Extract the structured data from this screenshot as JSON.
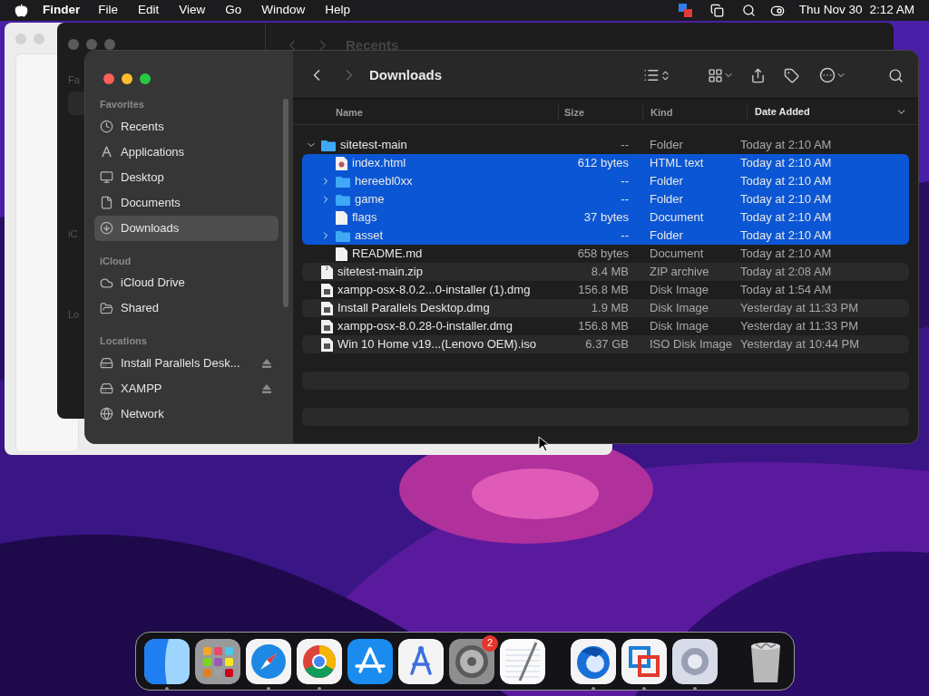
{
  "menu_bar": {
    "app": "Finder",
    "menus": [
      "File",
      "Edit",
      "View",
      "Go",
      "Window",
      "Help"
    ],
    "date": "Thu Nov 30",
    "time": "2:12 AM"
  },
  "back_window": {
    "title": "Recents",
    "sidebar_fragments": [
      "Fa",
      "iC",
      "Lo"
    ]
  },
  "finder": {
    "title": "Downloads",
    "sidebar": [
      {
        "heading": "Favorites",
        "items": [
          {
            "label": "Recents",
            "selected": false
          },
          {
            "label": "Applications",
            "selected": false
          },
          {
            "label": "Desktop",
            "selected": false
          },
          {
            "label": "Documents",
            "selected": false
          },
          {
            "label": "Downloads",
            "selected": true
          }
        ]
      },
      {
        "heading": "iCloud",
        "items": [
          {
            "label": "iCloud Drive",
            "selected": false
          },
          {
            "label": "Shared",
            "selected": false
          }
        ]
      },
      {
        "heading": "Locations",
        "items": [
          {
            "label": "Install Parallels Desk...",
            "selected": false,
            "ejectable": true
          },
          {
            "label": "XAMPP",
            "selected": false,
            "ejectable": true
          },
          {
            "label": "Network",
            "selected": false,
            "ejectable": false
          }
        ]
      }
    ],
    "columns": [
      {
        "label": "Name",
        "sorted": false
      },
      {
        "label": "Size",
        "sorted": false
      },
      {
        "label": "Kind",
        "sorted": false
      },
      {
        "label": "Date Added",
        "sorted": true
      }
    ],
    "rows": [
      {
        "name": "sitetest-main",
        "size": "--",
        "file_kind": "Folder",
        "date": "Today at 2:10 AM",
        "kind": "folder",
        "selected": false,
        "expanded": true,
        "children": [
          {
            "name": "index.html",
            "size": "612 bytes",
            "file_kind": "HTML text",
            "date": "Today at 2:10 AM",
            "kind": "html",
            "selected": true
          },
          {
            "name": "hereebl0xx",
            "size": "--",
            "file_kind": "Folder",
            "date": "Today at 2:10 AM",
            "kind": "folder",
            "selected": true,
            "expanded": false
          },
          {
            "name": "game",
            "size": "--",
            "file_kind": "Folder",
            "date": "Today at 2:10 AM",
            "kind": "folder",
            "selected": true,
            "expanded": false
          },
          {
            "name": "flags",
            "size": "37 bytes",
            "file_kind": "Document",
            "date": "Today at 2:10 AM",
            "kind": "document",
            "selected": true
          },
          {
            "name": "asset",
            "size": "--",
            "file_kind": "Folder",
            "date": "Today at 2:10 AM",
            "kind": "folder",
            "selected": true,
            "expanded": false
          },
          {
            "name": "README.md",
            "size": "658 bytes",
            "file_kind": "Document",
            "date": "Today at 2:10 AM",
            "kind": "document",
            "selected": false
          }
        ]
      },
      {
        "name": "sitetest-main.zip",
        "size": "8.4 MB",
        "file_kind": "ZIP archive",
        "date": "Today at 2:08 AM",
        "kind": "archive",
        "selected": false
      },
      {
        "name": "xampp-osx-8.0.2...0-installer (1).dmg",
        "size": "156.8 MB",
        "file_kind": "Disk Image",
        "date": "Today at 1:54 AM",
        "kind": "disk",
        "selected": false
      },
      {
        "name": "Install Parallels Desktop.dmg",
        "size": "1.9 MB",
        "file_kind": "Disk Image",
        "date": "Yesterday at 11:33 PM",
        "kind": "disk",
        "selected": false
      },
      {
        "name": "xampp-osx-8.0.28-0-installer.dmg",
        "size": "156.8 MB",
        "file_kind": "Disk Image",
        "date": "Yesterday at 11:33 PM",
        "kind": "disk",
        "selected": false
      },
      {
        "name": "Win 10 Home v19...(Lenovo OEM).iso",
        "size": "6.37 GB",
        "file_kind": "ISO Disk Image",
        "date": "Yesterday at 10:44 PM",
        "kind": "disk",
        "selected": false
      }
    ]
  },
  "dock": [
    {
      "kind": "app",
      "running": true
    },
    {
      "kind": "app",
      "running": false
    },
    {
      "kind": "app",
      "running": true
    },
    {
      "kind": "app",
      "running": true
    },
    {
      "kind": "app",
      "running": false
    },
    {
      "kind": "app",
      "running": false
    },
    {
      "kind": "app",
      "running": false,
      "badge": "2"
    },
    {
      "kind": "app",
      "running": false
    },
    {
      "kind": "separator"
    },
    {
      "kind": "app",
      "running": true
    },
    {
      "kind": "app",
      "running": true
    },
    {
      "kind": "app",
      "running": true
    },
    {
      "kind": "separator"
    },
    {
      "kind": "app",
      "running": false
    }
  ]
}
